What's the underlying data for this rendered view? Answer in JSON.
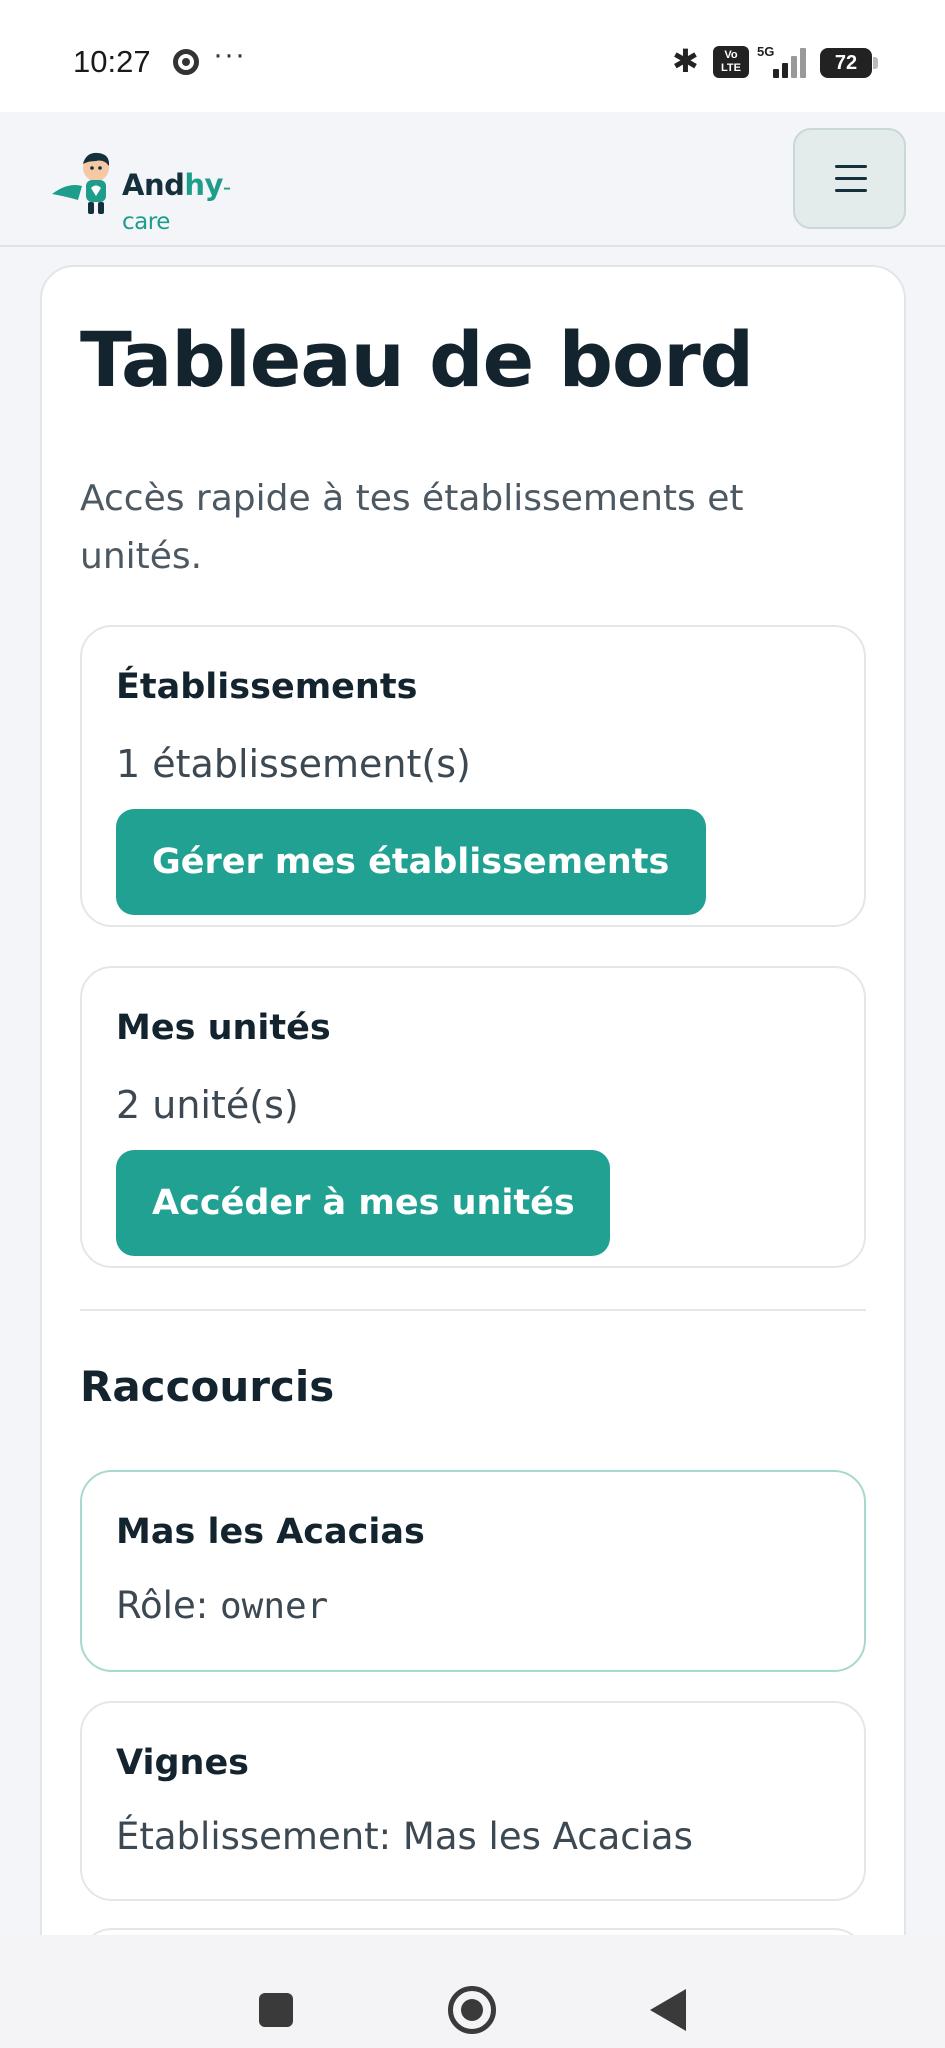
{
  "status_bar": {
    "time": "10:27",
    "dots": "···",
    "bluetooth_icon": "bluetooth-icon",
    "volte": "Vo LTE",
    "network": "5G",
    "battery": "72"
  },
  "header": {
    "logo": {
      "part1": "And",
      "part2": "hy",
      "part3": "-care"
    },
    "menu_icon": "hamburger-menu-icon"
  },
  "main": {
    "title": "Tableau de bord",
    "subtitle": "Accès rapide à tes établissements et unités.",
    "cards": [
      {
        "title": "Établissements",
        "count": "1 établissement(s)",
        "button": "Gérer mes établissements"
      },
      {
        "title": "Mes unités",
        "count": "2 unité(s)",
        "button": "Accéder à mes unités"
      }
    ],
    "shortcuts_title": "Raccourcis",
    "shortcuts": [
      {
        "title": "Mas les Acacias",
        "label": "Rôle: ",
        "value": "owner"
      },
      {
        "title": "Vignes",
        "text": "Établissement: Mas les Acacias"
      }
    ]
  },
  "colors": {
    "accent": "#20a192",
    "text_dark": "#13242f",
    "text_muted": "#4c5862",
    "active_border": "#a8d8cf"
  }
}
